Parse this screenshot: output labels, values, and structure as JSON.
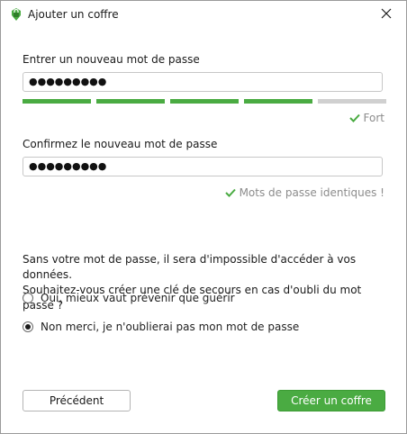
{
  "window": {
    "title": "Ajouter un coffre",
    "app_icon": "cryptomator-icon",
    "close_icon": "close-icon"
  },
  "new_password": {
    "label": "Entrer un nouveau mot de passe",
    "value": "●●●●●●●●●",
    "strength": {
      "filled_segments": 4,
      "total_segments": 5,
      "filled_color": "#4aab42",
      "empty_color": "#d0d0d0",
      "label": "Fort",
      "check_icon": "check-icon"
    }
  },
  "confirm_password": {
    "label": "Confirmez le nouveau mot de passe",
    "value": "●●●●●●●●●",
    "match_label": "Mots de passe identiques !",
    "check_icon": "check-icon"
  },
  "recovery": {
    "question_line1": "Sans votre mot de passe, il sera d'impossible d'accéder à vos données.",
    "question_line2": "Souhaitez-vous créer une clé de secours en cas d'oubli du mot passe ?",
    "options": [
      {
        "label": "Oui, mieux vaut prévenir que guérir",
        "selected": false
      },
      {
        "label": "Non merci, je n'oublierai pas mon mot de passe",
        "selected": true
      }
    ]
  },
  "buttons": {
    "previous": "Précédent",
    "create": "Créer un coffre"
  },
  "colors": {
    "accent": "#4aab42",
    "hint_text": "#8c8c8c"
  }
}
